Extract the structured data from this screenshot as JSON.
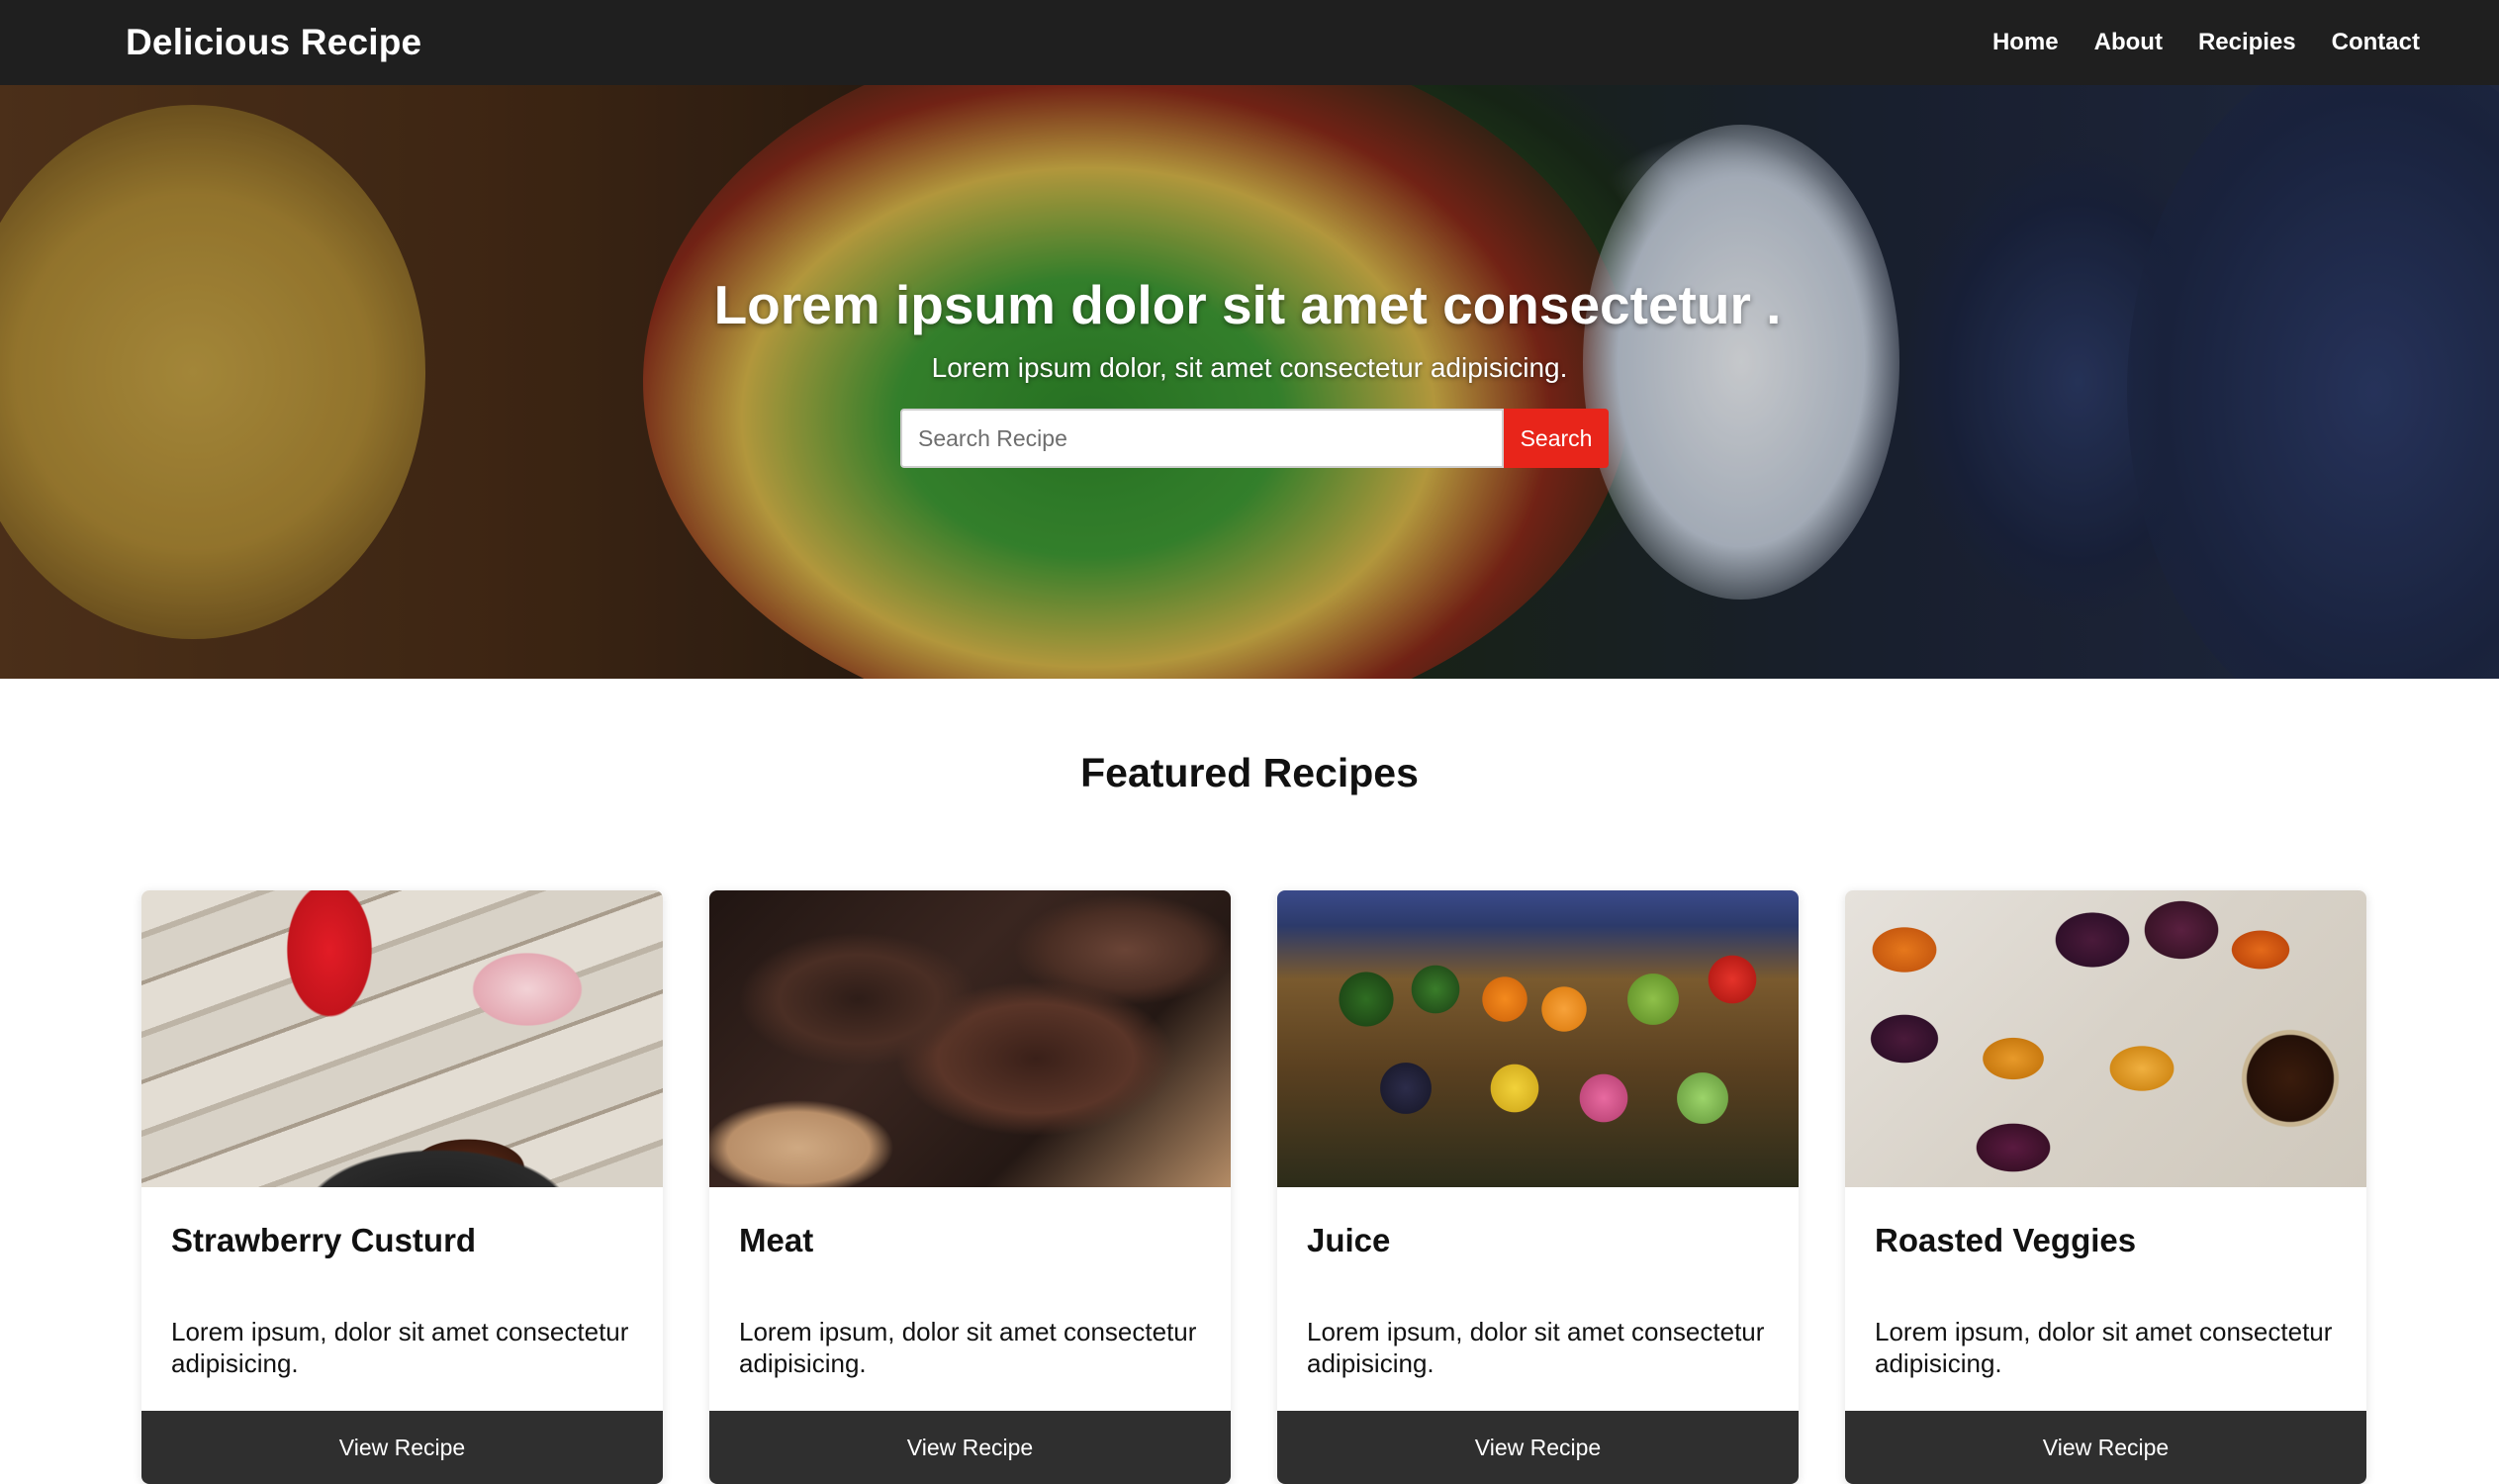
{
  "brand": "Delicious Recipe",
  "nav": {
    "items": [
      "Home",
      "About",
      "Recipies",
      "Contact"
    ]
  },
  "hero": {
    "title": "Lorem ipsum dolor sit amet consectetur .",
    "subtitle": "Lorem ipsum dolor, sit amet consectetur adipisicing.",
    "search_placeholder": "Search Recipe",
    "search_button": "Search"
  },
  "featured": {
    "title": "Featured Recipes",
    "cards": [
      {
        "title": "Strawberry Custurd",
        "text": "Lorem ipsum, dolor sit amet consectetur adipisicing.",
        "button": "View Recipe",
        "image": "strawberry-custard-image"
      },
      {
        "title": "Meat",
        "text": "Lorem ipsum, dolor sit amet consectetur adipisicing.",
        "button": "View Recipe",
        "image": "grilled-meat-image"
      },
      {
        "title": "Juice",
        "text": "Lorem ipsum, dolor sit amet consectetur adipisicing.",
        "button": "View Recipe",
        "image": "fruit-market-image"
      },
      {
        "title": "Roasted Veggies",
        "text": "Lorem ipsum, dolor sit amet consectetur adipisicing.",
        "button": "View Recipe",
        "image": "roasted-veggies-image"
      }
    ]
  },
  "colors": {
    "navbar_bg": "#1f1f1f",
    "search_button": "#e8251a",
    "card_button": "#2f2f2f"
  }
}
